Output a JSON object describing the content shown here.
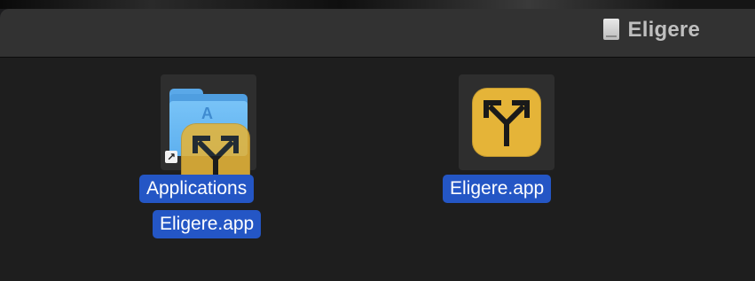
{
  "window": {
    "title": "Eligere",
    "title_icon": "external-disk-icon"
  },
  "items": {
    "applications": {
      "label": "Applications",
      "icon": "applications-folder-icon",
      "alias_icon": "alias-arrow-icon",
      "alias_glyph": "↗",
      "folder_glyph": "A"
    },
    "dragged_app": {
      "label": "Eligere.app",
      "icon": "eligere-app-icon"
    },
    "eligere_app": {
      "label": "Eligere.app",
      "icon": "eligere-app-icon"
    }
  },
  "colors": {
    "selection": "#2456c5",
    "app_icon_bg": "#e5b438",
    "titlebar": "#323232",
    "content_bg": "#1e1e1e",
    "folder_blue": "#5eb0ef"
  }
}
